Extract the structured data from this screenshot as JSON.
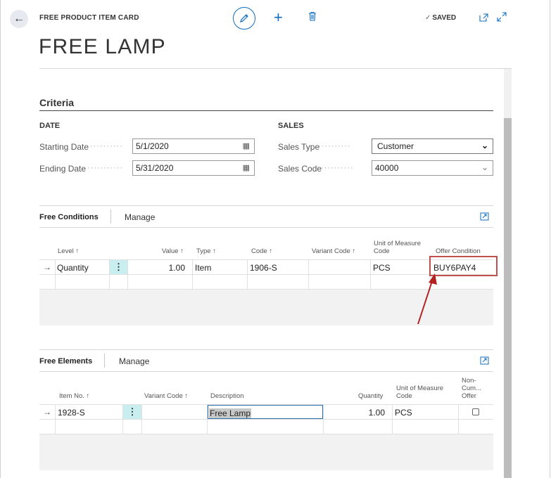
{
  "header": {
    "card_label": "FREE PRODUCT ITEM CARD",
    "title": "FREE LAMP",
    "status": "SAVED"
  },
  "icons": {
    "back": "back-arrow-icon",
    "edit": "pencil-icon",
    "add": "plus-icon",
    "delete": "trash-icon",
    "status": "checkmark-icon",
    "open_new": "open-in-new-window-icon",
    "expand": "expand-icon",
    "calendar": "calendar-icon",
    "dropdown": "chevron-down-icon",
    "share": "share-icon"
  },
  "colors": {
    "accent": "#0f6cbd",
    "highlight_box": "#c0504d",
    "row_action": "#c9eef0"
  },
  "criteria": {
    "title": "Criteria",
    "date": {
      "heading": "DATE",
      "starting_label": "Starting Date",
      "starting_value": "5/1/2020",
      "ending_label": "Ending Date",
      "ending_value": "5/31/2020"
    },
    "sales": {
      "heading": "SALES",
      "type_label": "Sales Type",
      "type_value": "Customer",
      "code_label": "Sales Code",
      "code_value": "40000"
    }
  },
  "free_conditions": {
    "title": "Free Conditions",
    "manage": "Manage",
    "columns": {
      "level": "Level ↑",
      "value": "Value ↑",
      "type": "Type ↑",
      "code": "Code ↑",
      "variant": "Variant Code ↑",
      "uom_1": "Unit of Measure",
      "uom_2": "Code",
      "offer": "Offer Condition"
    },
    "rows": [
      {
        "level": "Quantity",
        "value": "1.00",
        "type": "Item",
        "code": "1906-S",
        "variant": "",
        "uom": "PCS",
        "offer": "BUY6PAY4"
      }
    ]
  },
  "free_elements": {
    "title": "Free Elements",
    "manage": "Manage",
    "columns": {
      "item_no": "Item No. ↑",
      "variant": "Variant Code ↑",
      "description": "Description",
      "quantity": "Quantity",
      "uom_1": "Unit of Measure",
      "uom_2": "Code",
      "noncum_1": "Non-",
      "noncum_2": "Cum...",
      "noncum_3": "Offer"
    },
    "rows": [
      {
        "item_no": "1928-S",
        "variant": "",
        "description": "Free Lamp",
        "quantity": "1.00",
        "uom": "PCS",
        "non_cumulative": false
      }
    ]
  }
}
